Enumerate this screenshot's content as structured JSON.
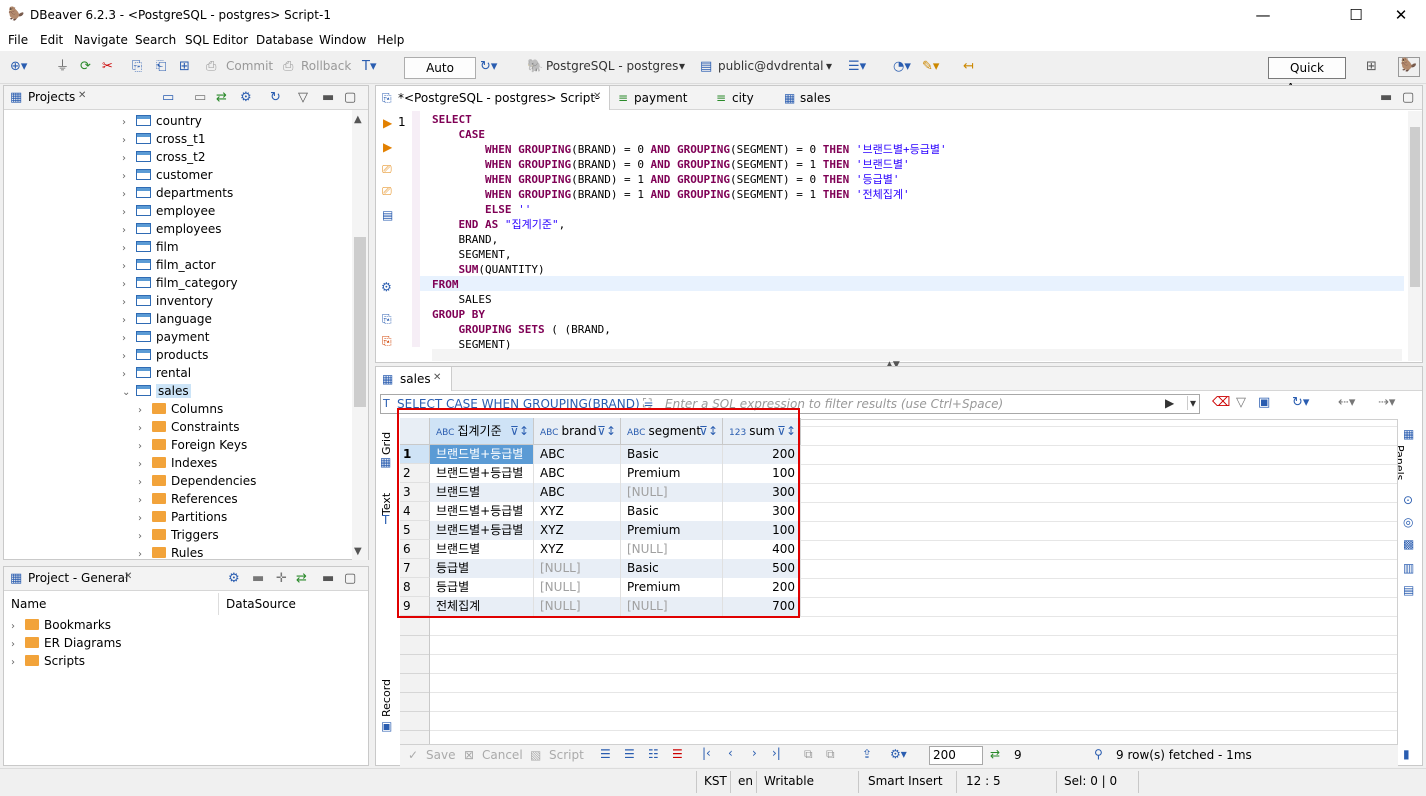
{
  "window": {
    "title": "DBeaver 6.2.3 - <PostgreSQL - postgres> Script-1",
    "minimize": "—",
    "maximize": "☐",
    "close": "✕"
  },
  "menu": [
    "File",
    "Edit",
    "Navigate",
    "Search",
    "SQL Editor",
    "Database",
    "Window",
    "Help"
  ],
  "toolbar": {
    "commit": "Commit",
    "rollback": "Rollback",
    "mode": "Auto",
    "connection": "PostgreSQL - postgres",
    "schema": "public@dvdrental",
    "quick_access": "Quick Access"
  },
  "projects_panel": {
    "title": "Projects",
    "tables": [
      "country",
      "cross_t1",
      "cross_t2",
      "customer",
      "departments",
      "employee",
      "employees",
      "film",
      "film_actor",
      "film_category",
      "inventory",
      "language",
      "payment",
      "products",
      "rental",
      "sales"
    ],
    "sales_children": [
      "Columns",
      "Constraints",
      "Foreign Keys",
      "Indexes",
      "Dependencies",
      "References",
      "Partitions",
      "Triggers",
      "Rules"
    ]
  },
  "project_general": {
    "title": "Project - General",
    "col_name": "Name",
    "col_datasource": "DataSource",
    "items": [
      "Bookmarks",
      "ER Diagrams",
      "Scripts"
    ]
  },
  "editor_tabs": [
    "*<PostgreSQL - postgres> Script-1",
    "payment",
    "city",
    "sales"
  ],
  "sql": [
    [
      [
        "kw",
        "SELECT"
      ]
    ],
    [
      [
        "",
        "    "
      ],
      [
        "kw",
        "CASE"
      ]
    ],
    [
      [
        "",
        "        "
      ],
      [
        "kw",
        "WHEN GROUPING"
      ],
      [
        "",
        "(BRAND) = "
      ],
      [
        "num",
        "0"
      ],
      [
        "kw",
        " AND GROUPING"
      ],
      [
        "",
        "(SEGMENT) = "
      ],
      [
        "num",
        "0"
      ],
      [
        "kw",
        " THEN "
      ],
      [
        "str",
        "'브랜드별+등급별'"
      ]
    ],
    [
      [
        "",
        "        "
      ],
      [
        "kw",
        "WHEN GROUPING"
      ],
      [
        "",
        "(BRAND) = "
      ],
      [
        "num",
        "0"
      ],
      [
        "kw",
        " AND GROUPING"
      ],
      [
        "",
        "(SEGMENT) = "
      ],
      [
        "num",
        "1"
      ],
      [
        "kw",
        " THEN "
      ],
      [
        "str",
        "'브랜드별'"
      ]
    ],
    [
      [
        "",
        "        "
      ],
      [
        "kw",
        "WHEN GROUPING"
      ],
      [
        "",
        "(BRAND) = "
      ],
      [
        "num",
        "1"
      ],
      [
        "kw",
        " AND GROUPING"
      ],
      [
        "",
        "(SEGMENT) = "
      ],
      [
        "num",
        "0"
      ],
      [
        "kw",
        " THEN "
      ],
      [
        "str",
        "'등급별'"
      ]
    ],
    [
      [
        "",
        "        "
      ],
      [
        "kw",
        "WHEN GROUPING"
      ],
      [
        "",
        "(BRAND) = "
      ],
      [
        "num",
        "1"
      ],
      [
        "kw",
        " AND GROUPING"
      ],
      [
        "",
        "(SEGMENT) = "
      ],
      [
        "num",
        "1"
      ],
      [
        "kw",
        " THEN "
      ],
      [
        "str",
        "'전체집계'"
      ]
    ],
    [
      [
        "",
        "        "
      ],
      [
        "kw",
        "ELSE "
      ],
      [
        "str",
        "''"
      ]
    ],
    [
      [
        "",
        "    "
      ],
      [
        "kw",
        "END AS "
      ],
      [
        "str",
        "\"집계기준\""
      ],
      [
        "",
        ","
      ]
    ],
    [
      [
        "",
        "    BRAND,"
      ]
    ],
    [
      [
        "",
        "    SEGMENT,"
      ]
    ],
    [
      [
        "",
        "    "
      ],
      [
        "kw",
        "SUM"
      ],
      [
        "",
        "(QUANTITY)"
      ]
    ],
    [
      [
        "kw",
        "FROM"
      ]
    ],
    [
      [
        "",
        "    SALES"
      ]
    ],
    [
      [
        "kw",
        "GROUP BY"
      ]
    ],
    [
      [
        "",
        "    "
      ],
      [
        "kw",
        "GROUPING SETS"
      ],
      [
        "",
        " ( (BRAND,"
      ]
    ],
    [
      [
        "",
        "    SEGMENT)"
      ]
    ]
  ],
  "results": {
    "tab": "sales",
    "query_prefix": "SELECT CASE WHEN GROUPING(BRAND) =",
    "filter_placeholder": "Enter a SQL expression to filter results (use Ctrl+Space)",
    "side_grid": "Grid",
    "side_text": "Text",
    "side_record": "Record",
    "side_panels": "Panels",
    "columns": [
      {
        "type": "ABC",
        "name": "집계기준"
      },
      {
        "type": "ABC",
        "name": "brand"
      },
      {
        "type": "ABC",
        "name": "segment"
      },
      {
        "type": "123",
        "name": "sum"
      }
    ],
    "rows": [
      [
        "1",
        "브랜드별+등급별",
        "ABC",
        "Basic",
        "200"
      ],
      [
        "2",
        "브랜드별+등급별",
        "ABC",
        "Premium",
        "100"
      ],
      [
        "3",
        "브랜드별",
        "ABC",
        "[NULL]",
        "300"
      ],
      [
        "4",
        "브랜드별+등급별",
        "XYZ",
        "Basic",
        "300"
      ],
      [
        "5",
        "브랜드별+등급별",
        "XYZ",
        "Premium",
        "100"
      ],
      [
        "6",
        "브랜드별",
        "XYZ",
        "[NULL]",
        "400"
      ],
      [
        "7",
        "등급별",
        "[NULL]",
        "Basic",
        "500"
      ],
      [
        "8",
        "등급별",
        "[NULL]",
        "Premium",
        "200"
      ],
      [
        "9",
        "전체집계",
        "[NULL]",
        "[NULL]",
        "700"
      ]
    ],
    "bottom": {
      "save": "Save",
      "cancel": "Cancel",
      "script": "Script",
      "fetch_size": "200",
      "count": "9",
      "fetched": "9 row(s) fetched - 1ms"
    }
  },
  "status": {
    "tz": "KST",
    "lang": "en",
    "mode": "Writable",
    "insert": "Smart Insert",
    "pos": "12 : 5",
    "sel": "Sel: 0 | 0"
  },
  "highlight_color": "#e00000"
}
